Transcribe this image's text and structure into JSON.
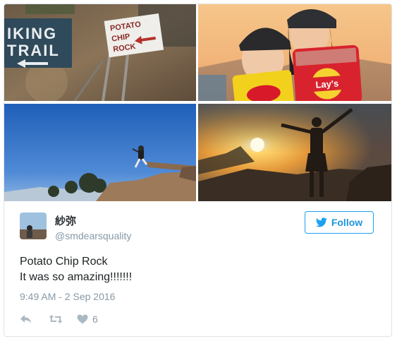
{
  "photos": [
    {
      "icon": "photo-trail-sign"
    },
    {
      "icon": "photo-selfie-chips"
    },
    {
      "icon": "photo-rock-jump"
    },
    {
      "icon": "photo-sunset-silhouette"
    }
  ],
  "sign": {
    "trail_line1": "IKING",
    "trail_line2": "TRAIL",
    "rock_line1": "POTATO",
    "rock_line2": "CHIP",
    "rock_line3": "ROCK",
    "chip_brand": "Lay's"
  },
  "user": {
    "display_name": "紗弥",
    "screen_name": "@smdearsquality",
    "avatar_icon": "avatar-icon"
  },
  "follow": {
    "label": "Follow",
    "icon": "twitter-bird-icon"
  },
  "tweet": {
    "lines": [
      "Potato Chip Rock",
      "It was so amazing!!!!!!!"
    ],
    "timestamp": "9:49 AM - 2 Sep 2016"
  },
  "actions": {
    "reply_icon": "reply-icon",
    "retweet_icon": "retweet-icon",
    "like_icon": "heart-icon",
    "like_count": "6"
  },
  "colors": {
    "accent": "#1da1f2",
    "text": "#1c2022",
    "muted": "#8899a6",
    "border": "#dfe3e6"
  }
}
